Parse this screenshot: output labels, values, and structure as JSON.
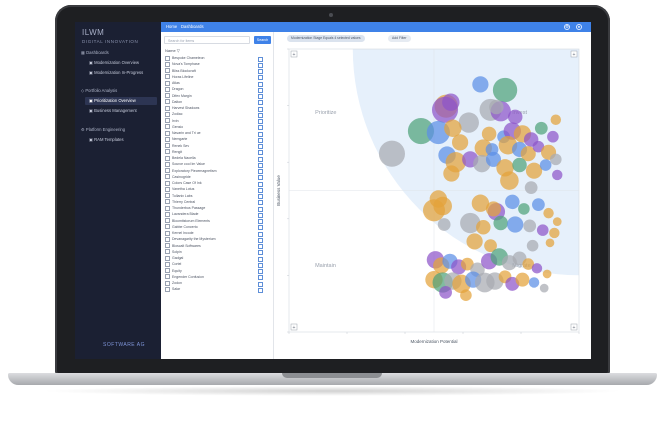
{
  "app": {
    "brand": "ILWM",
    "brand_sub": "DIGITAL INNOVATION",
    "footer_logo": "SOFTWARE AG"
  },
  "topbar": {
    "tab1": "Home",
    "tab2": "Dashboards"
  },
  "nav": {
    "sections": [
      {
        "label": "Dashboards",
        "items": [
          {
            "label": "Modernization Overview",
            "active": false
          },
          {
            "label": "Modernization In-Progress",
            "active": false
          }
        ]
      },
      {
        "label": "Portfolio Analysis",
        "items": [
          {
            "label": "Prioritization Overview",
            "active": true
          },
          {
            "label": "Business Management",
            "active": false
          }
        ]
      },
      {
        "label": "Platform Engineering",
        "items": [
          {
            "label": "RAM Templates",
            "active": false
          }
        ]
      }
    ]
  },
  "list": {
    "search_placeholder": "Search for items",
    "search_button": "Search",
    "header": "Name",
    "items": [
      "Bespoke Chameleon",
      "Nova's Tomphase",
      "Bliss Blockcraft",
      "Horas Lifeline",
      "Atlas",
      "Dragon",
      "Difex Margin",
      "Dalton",
      "Harvest Shadows",
      "Zodiac",
      "Irvin",
      "Gensio",
      "Navarin and Tri ue",
      "Nemgarte",
      "Renek Sev",
      "Rengit",
      "Bedela Nacella",
      "Source cool Im Value",
      "Exploratory Piecemagnetism",
      "Casinogride",
      "Colors Case Of Ink",
      "Vanetha Lotus",
      "Tullanix Labs",
      "Thierry Central",
      "Thunderbus Passage",
      "Lavandera Blade",
      "Bloomtistorum Elements",
      "Gabbe Concerto",
      "Kernel Incode",
      "Devanagarity the Mysterium",
      "Bloscalt Softwares",
      "Solpin",
      "Gadgal",
      "Cortel",
      "Equity",
      "Engender Confusion",
      "Zodon",
      "Salar"
    ]
  },
  "filters": {
    "chip1": "Modernization Stage Equals 4 selected values",
    "chip2": "Add Filter"
  },
  "chart_data": {
    "type": "scatter",
    "xlabel": "Modernization Potential",
    "ylabel": "Business Value",
    "xlim": [
      0,
      10
    ],
    "ylim": [
      0,
      10
    ],
    "quadrant_labels": [
      "Prioritize",
      "Invest",
      "Maintain",
      "Migrate"
    ],
    "corner_markers": [
      "+",
      "+",
      "+",
      "+"
    ],
    "colors": {
      "orange": "#e3a23a",
      "purple": "#8d55c9",
      "green": "#4fa27a",
      "blue": "#5b8fe6",
      "gray": "#a8abb1",
      "highlight": "#e6f0fb"
    },
    "points": [
      {
        "x": 7.45,
        "y": 8.55,
        "r": 0.42,
        "color": "green"
      },
      {
        "x": 6.6,
        "y": 8.75,
        "r": 0.28,
        "color": "blue"
      },
      {
        "x": 5.42,
        "y": 7.98,
        "r": 0.4,
        "color": "orange"
      },
      {
        "x": 5.38,
        "y": 7.85,
        "r": 0.45,
        "color": "purple"
      },
      {
        "x": 5.58,
        "y": 8.12,
        "r": 0.3,
        "color": "purple"
      },
      {
        "x": 6.95,
        "y": 7.85,
        "r": 0.38,
        "color": "gray"
      },
      {
        "x": 7.3,
        "y": 7.8,
        "r": 0.35,
        "color": "purple"
      },
      {
        "x": 7.15,
        "y": 7.95,
        "r": 0.25,
        "color": "gray"
      },
      {
        "x": 7.8,
        "y": 7.6,
        "r": 0.25,
        "color": "purple"
      },
      {
        "x": 4.55,
        "y": 7.1,
        "r": 0.45,
        "color": "green"
      },
      {
        "x": 6.2,
        "y": 7.4,
        "r": 0.35,
        "color": "gray"
      },
      {
        "x": 5.15,
        "y": 7.05,
        "r": 0.4,
        "color": "blue"
      },
      {
        "x": 5.65,
        "y": 7.2,
        "r": 0.3,
        "color": "orange"
      },
      {
        "x": 5.9,
        "y": 6.7,
        "r": 0.28,
        "color": "orange"
      },
      {
        "x": 6.9,
        "y": 7.0,
        "r": 0.25,
        "color": "orange"
      },
      {
        "x": 7.4,
        "y": 6.9,
        "r": 0.22,
        "color": "blue"
      },
      {
        "x": 7.7,
        "y": 7.1,
        "r": 0.3,
        "color": "purple"
      },
      {
        "x": 8.05,
        "y": 7.0,
        "r": 0.3,
        "color": "orange"
      },
      {
        "x": 8.35,
        "y": 6.8,
        "r": 0.25,
        "color": "purple"
      },
      {
        "x": 8.7,
        "y": 7.2,
        "r": 0.22,
        "color": "green"
      },
      {
        "x": 9.1,
        "y": 6.9,
        "r": 0.2,
        "color": "purple"
      },
      {
        "x": 9.2,
        "y": 7.5,
        "r": 0.18,
        "color": "orange"
      },
      {
        "x": 6.7,
        "y": 6.5,
        "r": 0.3,
        "color": "orange"
      },
      {
        "x": 7.0,
        "y": 6.45,
        "r": 0.22,
        "color": "blue"
      },
      {
        "x": 7.55,
        "y": 6.6,
        "r": 0.32,
        "color": "orange"
      },
      {
        "x": 7.95,
        "y": 6.45,
        "r": 0.26,
        "color": "blue"
      },
      {
        "x": 8.25,
        "y": 6.3,
        "r": 0.26,
        "color": "orange"
      },
      {
        "x": 8.6,
        "y": 6.55,
        "r": 0.2,
        "color": "purple"
      },
      {
        "x": 8.95,
        "y": 6.35,
        "r": 0.26,
        "color": "orange"
      },
      {
        "x": 9.2,
        "y": 6.1,
        "r": 0.2,
        "color": "gray"
      },
      {
        "x": 3.55,
        "y": 6.3,
        "r": 0.45,
        "color": "gray"
      },
      {
        "x": 5.45,
        "y": 6.25,
        "r": 0.3,
        "color": "blue"
      },
      {
        "x": 5.75,
        "y": 6.0,
        "r": 0.35,
        "color": "orange"
      },
      {
        "x": 6.25,
        "y": 6.1,
        "r": 0.28,
        "color": "purple"
      },
      {
        "x": 6.65,
        "y": 5.95,
        "r": 0.3,
        "color": "gray"
      },
      {
        "x": 7.05,
        "y": 6.1,
        "r": 0.26,
        "color": "blue"
      },
      {
        "x": 7.45,
        "y": 5.8,
        "r": 0.3,
        "color": "orange"
      },
      {
        "x": 7.95,
        "y": 5.9,
        "r": 0.25,
        "color": "green"
      },
      {
        "x": 8.45,
        "y": 5.7,
        "r": 0.28,
        "color": "orange"
      },
      {
        "x": 8.85,
        "y": 5.9,
        "r": 0.2,
        "color": "blue"
      },
      {
        "x": 9.25,
        "y": 5.55,
        "r": 0.18,
        "color": "purple"
      },
      {
        "x": 5.6,
        "y": 5.6,
        "r": 0.28,
        "color": "orange"
      },
      {
        "x": 7.6,
        "y": 5.35,
        "r": 0.32,
        "color": "orange"
      },
      {
        "x": 8.35,
        "y": 5.1,
        "r": 0.22,
        "color": "gray"
      },
      {
        "x": 5.15,
        "y": 4.7,
        "r": 0.3,
        "color": "orange"
      },
      {
        "x": 5.0,
        "y": 4.3,
        "r": 0.38,
        "color": "orange"
      },
      {
        "x": 5.3,
        "y": 4.45,
        "r": 0.32,
        "color": "orange"
      },
      {
        "x": 6.6,
        "y": 4.55,
        "r": 0.3,
        "color": "orange"
      },
      {
        "x": 7.15,
        "y": 4.25,
        "r": 0.3,
        "color": "purple"
      },
      {
        "x": 7.05,
        "y": 4.35,
        "r": 0.26,
        "color": "orange"
      },
      {
        "x": 7.7,
        "y": 4.6,
        "r": 0.25,
        "color": "blue"
      },
      {
        "x": 8.1,
        "y": 4.35,
        "r": 0.2,
        "color": "green"
      },
      {
        "x": 8.6,
        "y": 4.5,
        "r": 0.22,
        "color": "blue"
      },
      {
        "x": 8.95,
        "y": 4.2,
        "r": 0.18,
        "color": "orange"
      },
      {
        "x": 9.25,
        "y": 3.9,
        "r": 0.15,
        "color": "orange"
      },
      {
        "x": 5.35,
        "y": 3.8,
        "r": 0.22,
        "color": "gray"
      },
      {
        "x": 6.25,
        "y": 3.85,
        "r": 0.35,
        "color": "gray"
      },
      {
        "x": 6.7,
        "y": 3.7,
        "r": 0.25,
        "color": "orange"
      },
      {
        "x": 7.3,
        "y": 3.85,
        "r": 0.25,
        "color": "green"
      },
      {
        "x": 7.8,
        "y": 3.8,
        "r": 0.28,
        "color": "blue"
      },
      {
        "x": 8.3,
        "y": 3.75,
        "r": 0.22,
        "color": "gray"
      },
      {
        "x": 8.75,
        "y": 3.6,
        "r": 0.2,
        "color": "purple"
      },
      {
        "x": 9.15,
        "y": 3.5,
        "r": 0.18,
        "color": "orange"
      },
      {
        "x": 6.4,
        "y": 3.2,
        "r": 0.28,
        "color": "orange"
      },
      {
        "x": 6.95,
        "y": 3.05,
        "r": 0.22,
        "color": "orange"
      },
      {
        "x": 8.4,
        "y": 3.05,
        "r": 0.2,
        "color": "gray"
      },
      {
        "x": 9.0,
        "y": 3.15,
        "r": 0.15,
        "color": "orange"
      },
      {
        "x": 5.05,
        "y": 2.55,
        "r": 0.3,
        "color": "purple"
      },
      {
        "x": 5.25,
        "y": 2.35,
        "r": 0.28,
        "color": "orange"
      },
      {
        "x": 5.55,
        "y": 2.5,
        "r": 0.26,
        "color": "blue"
      },
      {
        "x": 5.85,
        "y": 2.3,
        "r": 0.26,
        "color": "purple"
      },
      {
        "x": 6.15,
        "y": 2.4,
        "r": 0.22,
        "color": "orange"
      },
      {
        "x": 6.5,
        "y": 2.2,
        "r": 0.25,
        "color": "gray"
      },
      {
        "x": 6.9,
        "y": 2.5,
        "r": 0.28,
        "color": "purple"
      },
      {
        "x": 7.25,
        "y": 2.65,
        "r": 0.3,
        "color": "green"
      },
      {
        "x": 7.6,
        "y": 2.45,
        "r": 0.26,
        "color": "gray"
      },
      {
        "x": 7.95,
        "y": 2.6,
        "r": 0.24,
        "color": "gray"
      },
      {
        "x": 8.25,
        "y": 2.4,
        "r": 0.2,
        "color": "orange"
      },
      {
        "x": 8.55,
        "y": 2.25,
        "r": 0.18,
        "color": "purple"
      },
      {
        "x": 8.9,
        "y": 2.05,
        "r": 0.15,
        "color": "orange"
      },
      {
        "x": 5.0,
        "y": 1.85,
        "r": 0.3,
        "color": "orange"
      },
      {
        "x": 5.3,
        "y": 1.75,
        "r": 0.35,
        "color": "green"
      },
      {
        "x": 5.65,
        "y": 1.8,
        "r": 0.3,
        "color": "gray"
      },
      {
        "x": 5.95,
        "y": 1.7,
        "r": 0.32,
        "color": "orange"
      },
      {
        "x": 6.35,
        "y": 1.85,
        "r": 0.28,
        "color": "blue"
      },
      {
        "x": 6.75,
        "y": 1.75,
        "r": 0.34,
        "color": "gray"
      },
      {
        "x": 7.1,
        "y": 1.8,
        "r": 0.3,
        "color": "gray"
      },
      {
        "x": 7.45,
        "y": 1.95,
        "r": 0.22,
        "color": "orange"
      },
      {
        "x": 7.7,
        "y": 1.7,
        "r": 0.24,
        "color": "purple"
      },
      {
        "x": 8.05,
        "y": 1.85,
        "r": 0.24,
        "color": "orange"
      },
      {
        "x": 8.45,
        "y": 1.75,
        "r": 0.18,
        "color": "blue"
      },
      {
        "x": 8.8,
        "y": 1.55,
        "r": 0.15,
        "color": "gray"
      },
      {
        "x": 5.4,
        "y": 1.4,
        "r": 0.22,
        "color": "purple"
      },
      {
        "x": 6.1,
        "y": 1.3,
        "r": 0.2,
        "color": "orange"
      }
    ]
  }
}
